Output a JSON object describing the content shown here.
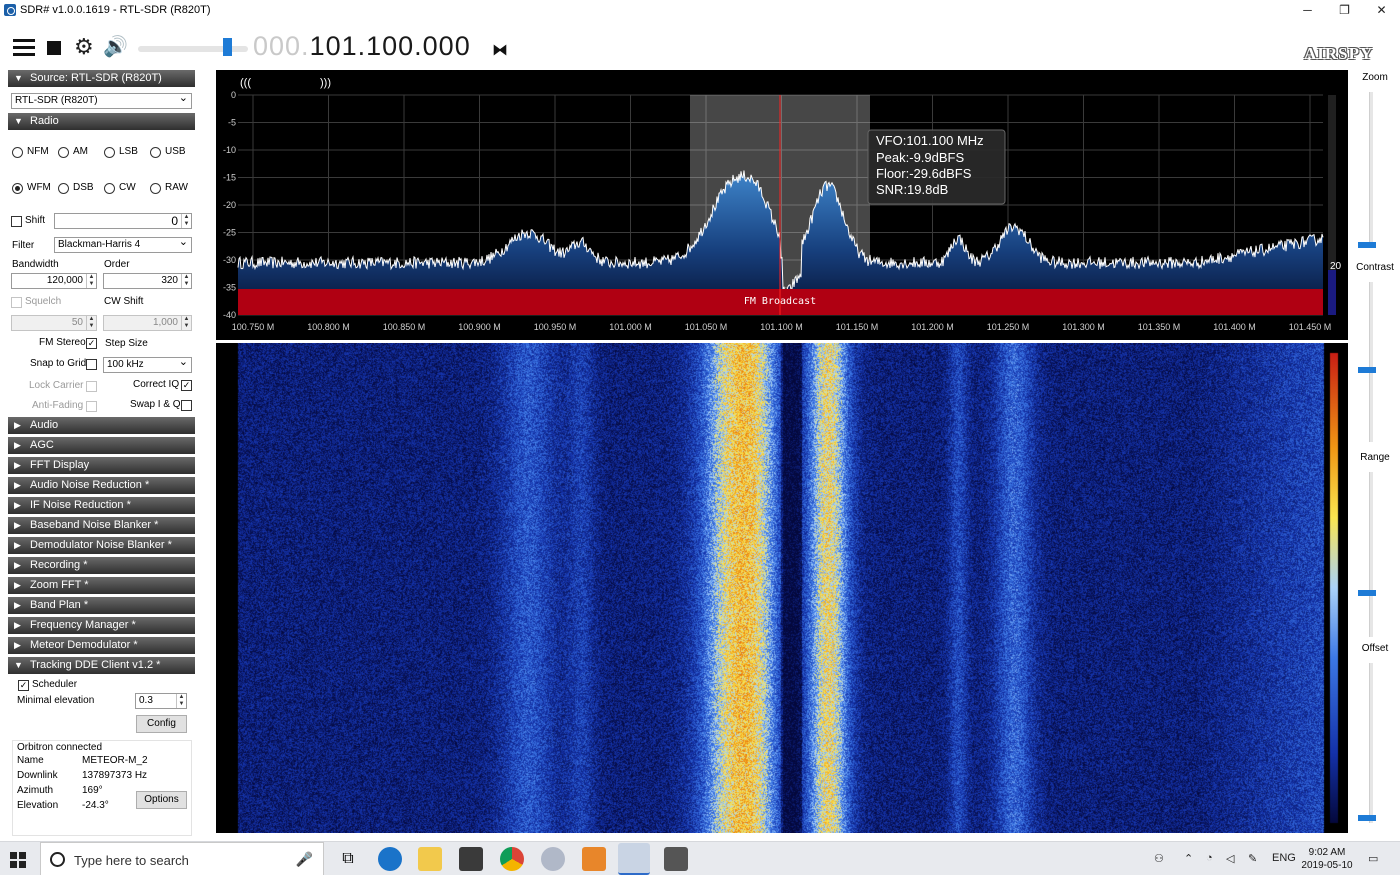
{
  "window": {
    "title": "SDR# v1.0.0.1619 - RTL-SDR (R820T)",
    "minimize": "─",
    "maximize": "❐",
    "close": "✕"
  },
  "toolbar": {
    "frequency_dim": "000.",
    "frequency_main": "101.100.000",
    "logo_text": "AIRSPY",
    "gear_glyph": "⚙",
    "speaker_glyph": "🔊",
    "tune_glyph": "⧓"
  },
  "source": {
    "header": "Source: RTL-SDR (R820T)",
    "device": "RTL-SDR (R820T)"
  },
  "radio": {
    "header": "Radio",
    "modes": [
      {
        "label": "NFM",
        "selected": false
      },
      {
        "label": "AM",
        "selected": false
      },
      {
        "label": "LSB",
        "selected": false
      },
      {
        "label": "USB",
        "selected": false
      },
      {
        "label": "WFM",
        "selected": true
      },
      {
        "label": "DSB",
        "selected": false
      },
      {
        "label": "CW",
        "selected": false
      },
      {
        "label": "RAW",
        "selected": false
      }
    ],
    "shift_label": "Shift",
    "shift_value": "0",
    "filter_label": "Filter",
    "filter_value": "Blackman-Harris 4",
    "bandwidth_label": "Bandwidth",
    "bandwidth_value": "120,000",
    "order_label": "Order",
    "order_value": "320",
    "squelch_label": "Squelch",
    "cwshift_label": "CW Shift",
    "squelch_value": "50",
    "cwshift_value": "1,000",
    "fm_stereo_label": "FM Stereo",
    "step_size_label": "Step Size",
    "snap_label": "Snap to Grid",
    "step_value": "100 kHz",
    "lock_carrier_label": "Lock Carrier",
    "correct_iq_label": "Correct IQ",
    "anti_fading_label": "Anti-Fading",
    "swap_iq_label": "Swap I & Q"
  },
  "plugins": [
    "Audio",
    "AGC",
    "FFT Display",
    "Audio Noise Reduction *",
    "IF Noise Reduction *",
    "Baseband Noise Blanker *",
    "Demodulator Noise Blanker *",
    "Recording *",
    "Zoom FFT *",
    "Band Plan *",
    "Frequency Manager *",
    "Meteor Demodulator *"
  ],
  "tracking": {
    "header": "Tracking DDE Client v1.2 *",
    "scheduler_label": "Scheduler",
    "min_elev_label": "Minimal elevation",
    "min_elev_value": "0.3",
    "config_button": "Config",
    "connected": "Orbitron connected",
    "name_label": "Name",
    "name_value": "METEOR-M_2",
    "downlink_label": "Downlink",
    "downlink_value": "137897373 Hz",
    "azimuth_label": "Azimuth",
    "azimuth_value": "169°",
    "elevation_label": "Elevation",
    "elevation_value": "-24.3°",
    "options_button": "Options"
  },
  "spectrum": {
    "left_marker": "(((",
    "right_marker": ")))",
    "y_ticks": [
      "0",
      "-5",
      "-10",
      "-15",
      "-20",
      "-25",
      "-30",
      "-35",
      "-40"
    ],
    "x_ticks": [
      "100.750 M",
      "100.800 M",
      "100.850 M",
      "100.900 M",
      "100.950 M",
      "101.000 M",
      "101.050 M",
      "101.100 M",
      "101.150 M",
      "101.200 M",
      "101.250 M",
      "101.300 M",
      "101.350 M",
      "101.400 M",
      "101.450 M"
    ],
    "band_label": "FM Broadcast",
    "tooltip": {
      "vfo": "VFO:101.100 MHz",
      "peak": "Peak:-9.9dBFS",
      "floor": "Floor:-29.6dBFS",
      "snr": "SNR:19.8dB"
    },
    "side_value": "20",
    "colors": {
      "trace": "#ffffff",
      "fill": "#1d5fae",
      "band": "#b00012",
      "vfo": "#ff2020"
    }
  },
  "right_controls": {
    "zoom": "Zoom",
    "contrast": "Contrast",
    "range": "Range",
    "offset": "Offset"
  },
  "taskbar": {
    "search_placeholder": "Type here to search",
    "language": "ENG",
    "time": "9:02 AM",
    "date": "2019-05-10"
  }
}
